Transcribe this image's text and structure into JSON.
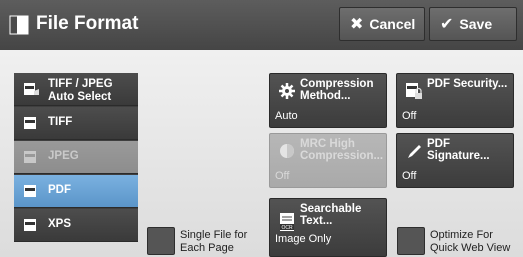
{
  "header": {
    "title": "File Format",
    "cancel_label": "Cancel",
    "save_label": "Save"
  },
  "formats": [
    {
      "label": "TIFF / JPEG Auto Select",
      "line1": "TIFF / JPEG",
      "line2": "Auto Select",
      "state": "normal"
    },
    {
      "label": "TIFF",
      "state": "normal"
    },
    {
      "label": "JPEG",
      "state": "disabled"
    },
    {
      "label": "PDF",
      "state": "selected"
    },
    {
      "label": "XPS",
      "state": "normal"
    }
  ],
  "single_file": {
    "line1": "Single File for",
    "line2": "Each Page"
  },
  "settings": {
    "compression": {
      "line1": "Compression",
      "line2": "Method...",
      "value": "Auto"
    },
    "mrc": {
      "line1": "MRC High",
      "line2": "Compression...",
      "value": "Off"
    },
    "searchable": {
      "line1": "Searchable",
      "line2": "Text...",
      "value": "Image Only",
      "icon_text": "OCR"
    },
    "pdf_security": {
      "line1": "PDF Security...",
      "value": "Off"
    },
    "pdf_signature": {
      "line1": "PDF Signature...",
      "value": "Off"
    }
  },
  "optimize": {
    "line1": "Optimize For",
    "line2": "Quick Web View"
  },
  "colors": {
    "header": "#4a4a4a",
    "selected": "#6aa2d6",
    "tile": "#474747",
    "disabled": "#b0b0b0"
  }
}
